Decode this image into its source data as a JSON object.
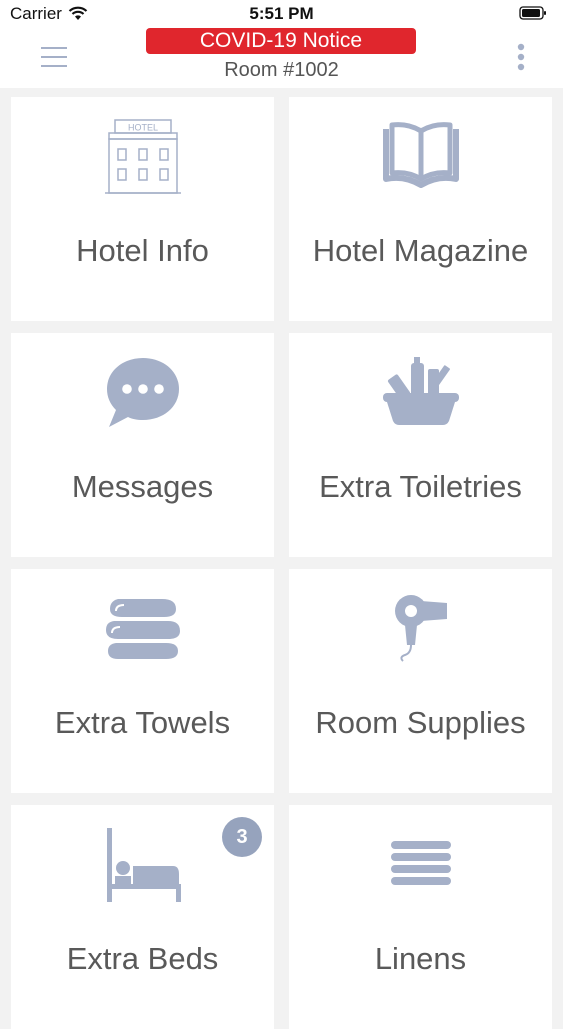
{
  "status_bar": {
    "carrier": "Carrier",
    "time": "5:51 PM"
  },
  "header": {
    "notice_label": "COVID-19 Notice",
    "room_label": "Room #1002"
  },
  "tiles": [
    {
      "label": "Hotel Info",
      "icon": "hotel-building-icon",
      "icon_text": "HOTEL"
    },
    {
      "label": "Hotel Magazine",
      "icon": "open-book-icon"
    },
    {
      "label": "Messages",
      "icon": "chat-bubble-icon"
    },
    {
      "label": "Extra Toiletries",
      "icon": "toiletries-basket-icon"
    },
    {
      "label": "Extra Towels",
      "icon": "folded-towels-icon"
    },
    {
      "label": "Room Supplies",
      "icon": "hair-dryer-icon"
    },
    {
      "label": "Extra Beds",
      "icon": "bed-icon",
      "badge": "3"
    },
    {
      "label": "Linens",
      "icon": "linens-stack-icon"
    }
  ],
  "colors": {
    "icon": "#a5b0c8",
    "notice_bg": "#e0262d",
    "badge_bg": "#96a3bd"
  }
}
